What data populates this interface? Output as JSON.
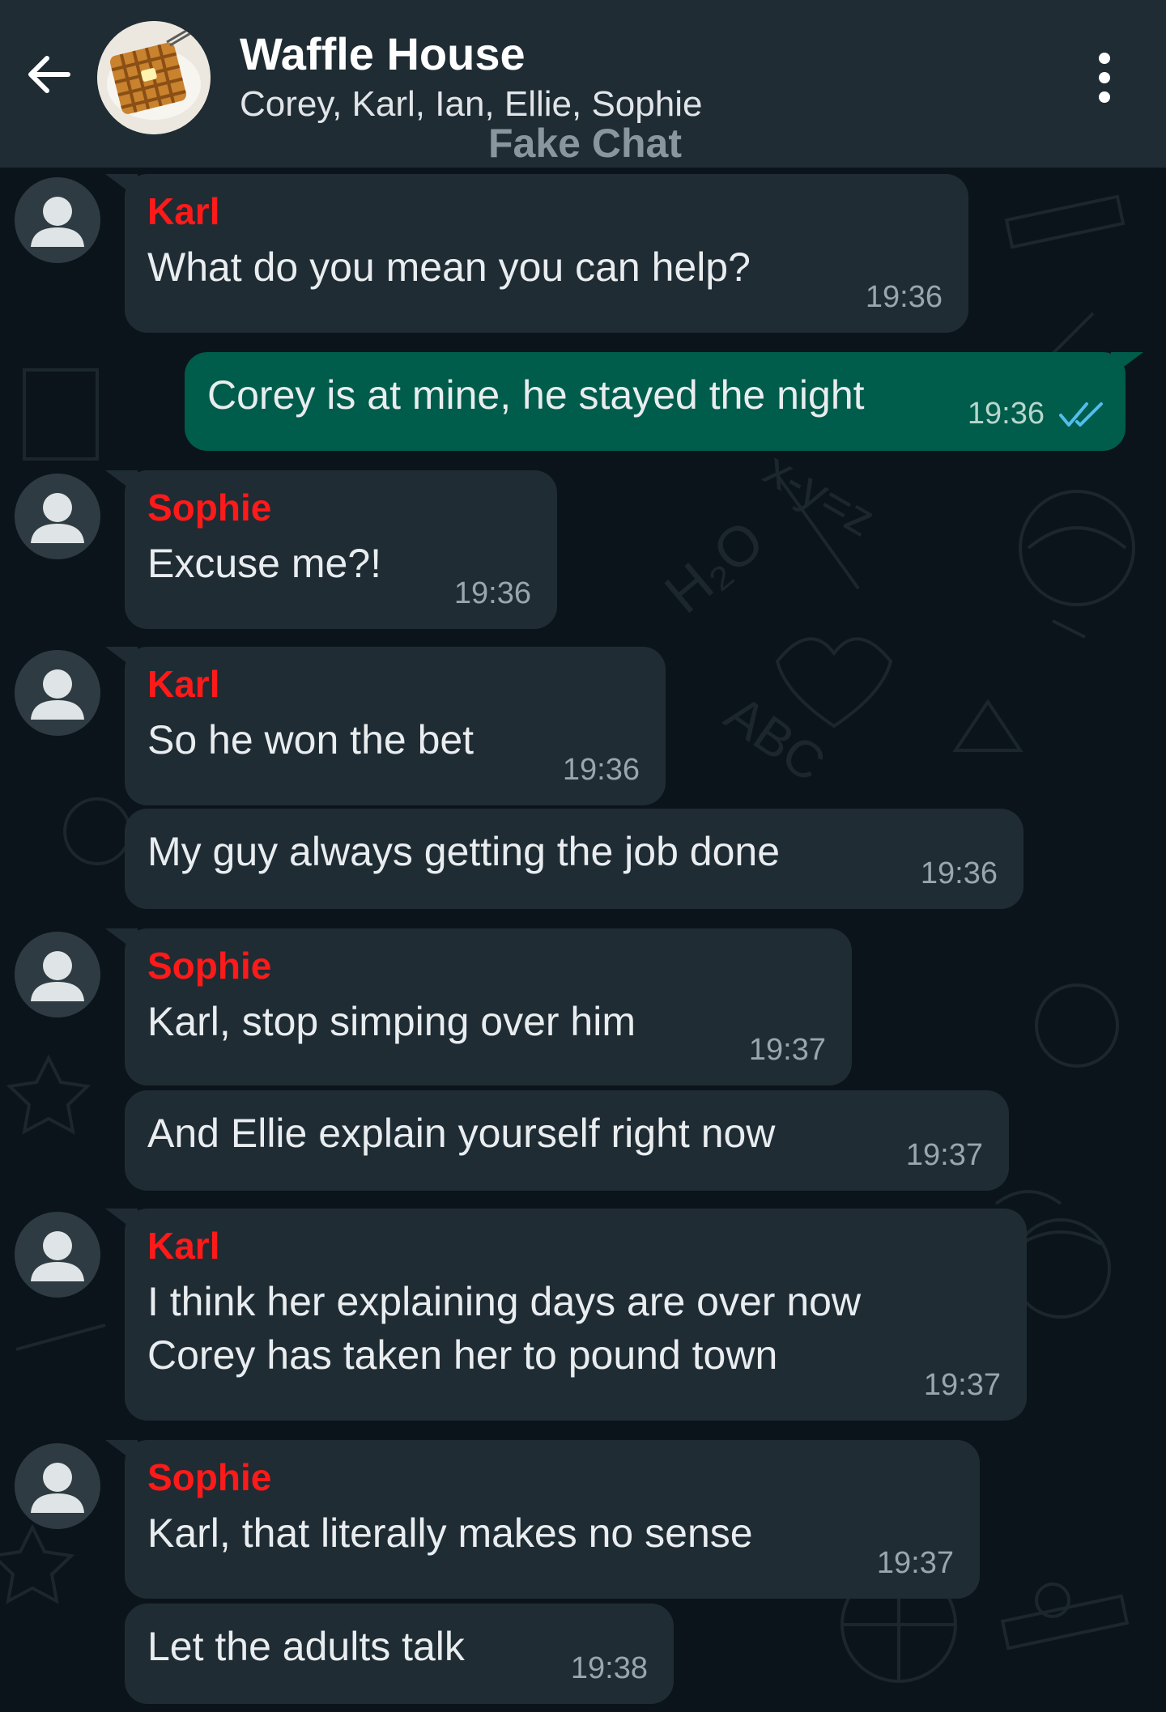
{
  "header": {
    "title": "Waffle House",
    "members": "Corey, Karl, Ian, Ellie, Sophie",
    "watermark": "Fake Chat",
    "back_icon": "arrow-left-icon",
    "menu_icon": "more-vertical-icon"
  },
  "colors": {
    "header_bg": "#1f2c34",
    "chat_bg": "#0b141a",
    "incoming_bubble": "#1f2c34",
    "outgoing_bubble": "#005c4b",
    "sender_name": "#ff1a1a",
    "read_ticks": "#53bdeb"
  },
  "messages": [
    {
      "sender": "Karl",
      "text": "What do you mean you can help?",
      "time": "19:36"
    },
    {
      "sender": "",
      "text": "Corey is at mine, he stayed the night",
      "time": "19:36",
      "outgoing": true,
      "status": "read"
    },
    {
      "sender": "Sophie",
      "text": "Excuse me?!",
      "time": "19:36"
    },
    {
      "sender": "Karl",
      "text": "So he won the bet",
      "time": "19:36"
    },
    {
      "sender": "",
      "text": "My guy always getting the job done",
      "time": "19:36"
    },
    {
      "sender": "Sophie",
      "text": "Karl, stop simping over him",
      "time": "19:37"
    },
    {
      "sender": "",
      "text": "And Ellie explain yourself right now",
      "time": "19:37"
    },
    {
      "sender": "Karl",
      "text": "I think her explaining days are over now\nCorey has taken her to pound town",
      "time": "19:37"
    },
    {
      "sender": "Sophie",
      "text": "Karl, that literally makes no sense",
      "time": "19:37"
    },
    {
      "sender": "",
      "text": "Let the adults talk",
      "time": "19:38"
    }
  ]
}
